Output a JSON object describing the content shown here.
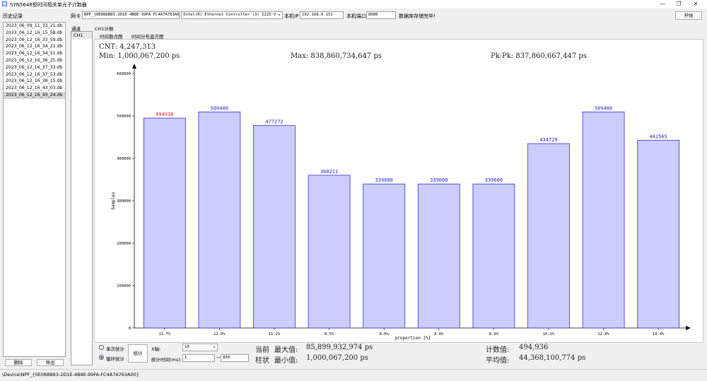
{
  "window": {
    "title": "SYN5648型时间相关单光子计数器",
    "controls": [
      "—",
      "❐",
      "✕"
    ]
  },
  "sidebar": {
    "label": "历史记录",
    "items": [
      "2023_06_09_11_33_21.db",
      "2023_06_12_16_15_58.db",
      "2023_06_12_16_33_59.db",
      "2023_06_12_16_34_21.db",
      "2023_06_12_16_34_51.db",
      "2023_06_12_16_36_25.db",
      "2023_06_12_16_37_33.db",
      "2023_06_12_16_37_53.db",
      "2023_06_12_16_38_15.db",
      "2023_06_12_16_43_03.db",
      "2023_06_12_16_43_24.db"
    ],
    "selected_index": 10,
    "delete_label": "删除",
    "export_label": "导出"
  },
  "toolbar": {
    "nic_label": "网卡",
    "nic_value": "NPF_{0E088B83-2D1E-4B8E-99FA-FC4A7A763A00}",
    "adapter_value": "Intel(R) Ethernet Controller (3) I225-V",
    "ip_label": "本机IP",
    "ip_value": "192.168.0.151",
    "port_label": "本机端口",
    "port_value": "8080",
    "status": "数据库存储完毕!",
    "start_label": "开始"
  },
  "tabs": {
    "channel_tab": "通道",
    "count_tab": "CH1计数",
    "ch_item": "CH1",
    "sub_tabs": [
      "时间散点图",
      "时间分布直方图"
    ],
    "active_sub_tab": 1
  },
  "stats": {
    "cnt": "CNT: 4,247,313",
    "min": "Min: 1,000,067,200 ps",
    "max": "Max: 838,860,734,647 ps",
    "pkpk": "Pk-Pk: 837,860,667,447 ps"
  },
  "chart_data": {
    "type": "bar",
    "categories": [
      "11.7%",
      "12.0%",
      "11.2%",
      "8.5%",
      "8.0%",
      "8.0%",
      "8.0%",
      "10.2%",
      "12.0%",
      "10.4%"
    ],
    "values": [
      494936,
      509400,
      477272,
      360211,
      339600,
      339600,
      339600,
      434729,
      509400,
      442565
    ],
    "data_labels": [
      "494936",
      "509400",
      "477272",
      "360211",
      "339600",
      "339600",
      "339600",
      "434729",
      "509400",
      "442565"
    ],
    "highlight_index": 0,
    "ylabel": "Samples",
    "xlabel": "proportion [%]",
    "ylim": [
      0,
      600000
    ],
    "yticks": [
      "0",
      "100000",
      "200000",
      "300000",
      "400000",
      "500000",
      "600000"
    ],
    "colors": {
      "bar_fill": "#ccccff",
      "bar_stroke": "#3333cc",
      "label": "#2222cc",
      "label_highlight": "#e02020"
    }
  },
  "controls": {
    "single_label": "单次统计",
    "loop_label": "循环统计",
    "loop_selected": true,
    "stat_button": "统计",
    "xaxis_label": "X轴:",
    "xaxis_value": "10",
    "time_label": "统计时间(ms):",
    "time_from": "1",
    "time_sep": "~",
    "time_to": "850"
  },
  "summary": {
    "row1_prefix": "当前",
    "max_label": "最大值:",
    "max_value": "85,899,932,974 ps",
    "row2_prefix": "柱状",
    "min_label": "最小值:",
    "min_value": "1,000,067,200  ps",
    "count_label": "计数值:",
    "count_value": "494,936",
    "avg_label": "平均值:",
    "avg_value": "44,368,100,774 ps"
  },
  "statusbar": {
    "text": "\\Device\\NPF_{0E088B83-2D1E-4B8E-99FA-FC4A7A763A00}"
  }
}
